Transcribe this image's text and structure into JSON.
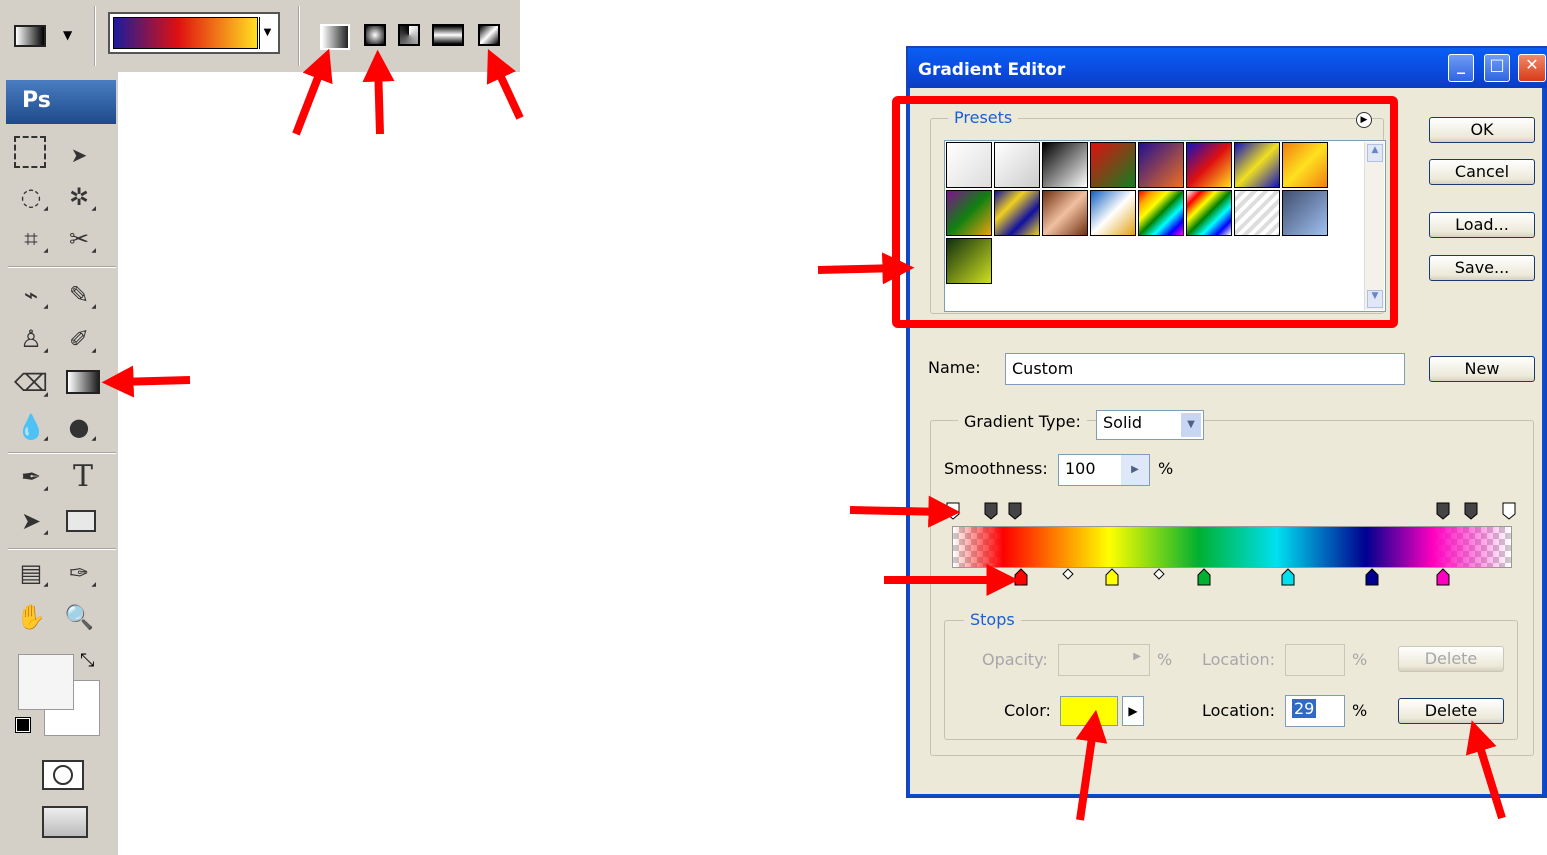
{
  "toolbox": {
    "logo": "Ps",
    "tools": [
      "marquee-icon",
      "move-icon",
      "lasso-icon",
      "magic-wand-icon",
      "crop-icon",
      "slice-icon",
      "healing-brush-icon",
      "brush-icon",
      "clone-stamp-icon",
      "history-brush-icon",
      "eraser-icon",
      "gradient-icon",
      "blur-icon",
      "dodge-icon",
      "pen-icon",
      "type-icon",
      "path-selection-icon",
      "rectangle-icon",
      "notes-icon",
      "eyedropper-icon",
      "hand-icon",
      "zoom-icon"
    ],
    "type_glyph": "T"
  },
  "dialog": {
    "title": "Gradient Editor",
    "presets_label": "Presets",
    "ok": "OK",
    "cancel": "Cancel",
    "load": "Load...",
    "save": "Save...",
    "name_label": "Name:",
    "name_value": "Custom",
    "new": "New",
    "gradient_type_label": "Gradient Type:",
    "gradient_type_value": "Solid",
    "smoothness_label": "Smoothness:",
    "smoothness_value": "100",
    "percent": "%",
    "stops_label": "Stops",
    "opacity_label": "Opacity:",
    "location_label": "Location:",
    "color_label": "Color:",
    "location_value": "29",
    "delete": "Delete",
    "color_value": "#ffff00"
  },
  "colors": {
    "annotation": "#ff0000",
    "xp_blue": "#0a4bd6",
    "link_blue": "#1b5fd6"
  }
}
